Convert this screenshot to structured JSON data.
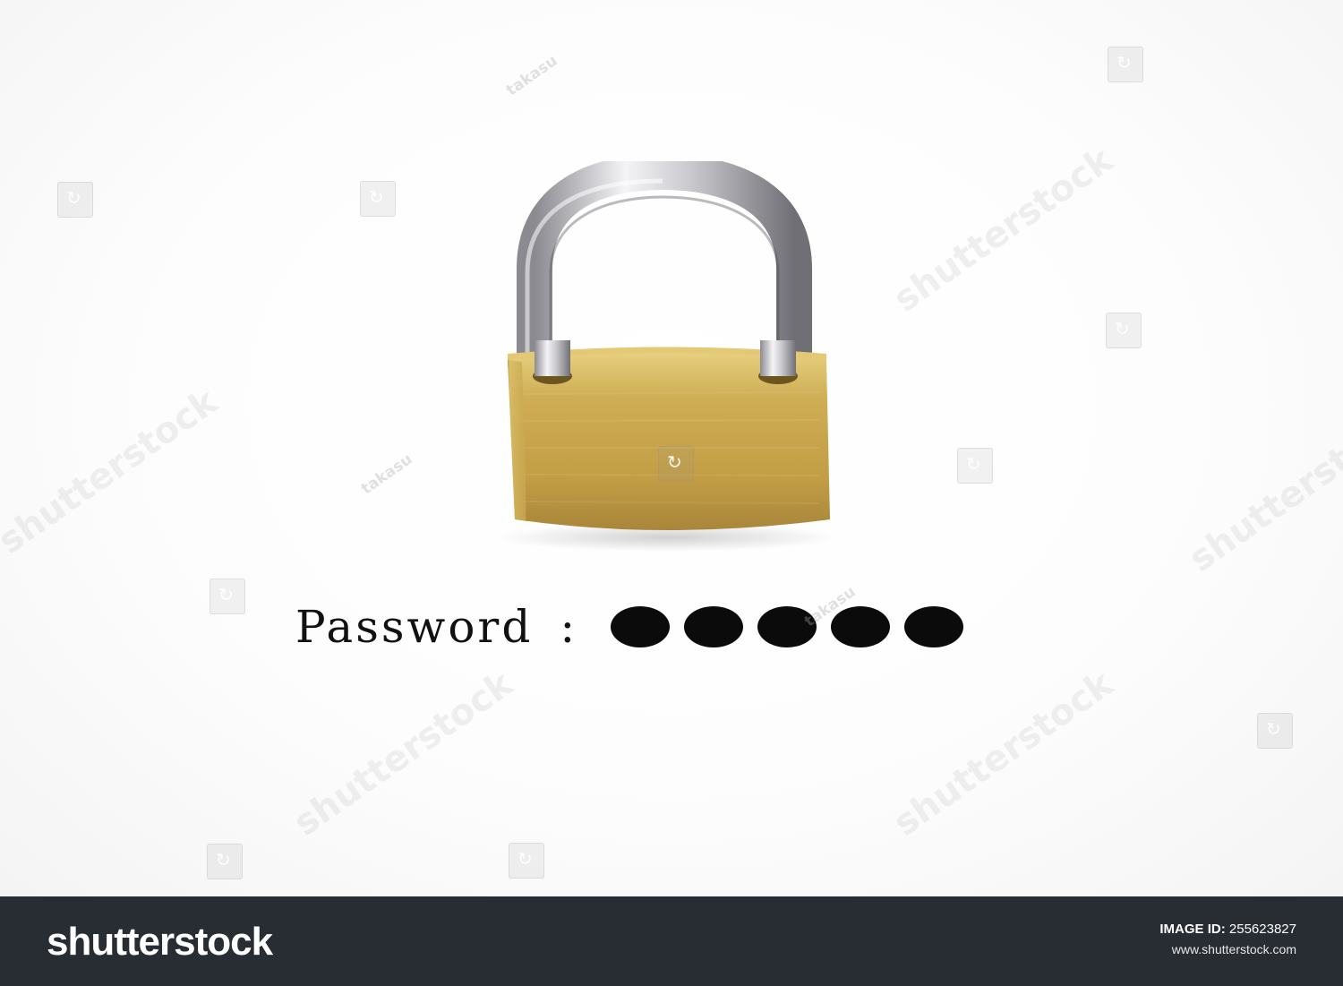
{
  "scene": {
    "password_label": "Password",
    "separator": ":",
    "masked_dot_count": 5
  },
  "watermark": {
    "brand_text": "shutterstock",
    "author_text": "takasu"
  },
  "footer": {
    "logo_text": "shutterstock",
    "image_id_label": "IMAGE ID:",
    "image_id_value": "255623827",
    "url": "www.shutterstock.com"
  },
  "colors": {
    "footer_bg": "#282c33",
    "brass": "#c9a548",
    "steel": "#cfcfd3",
    "text": "#111111"
  }
}
